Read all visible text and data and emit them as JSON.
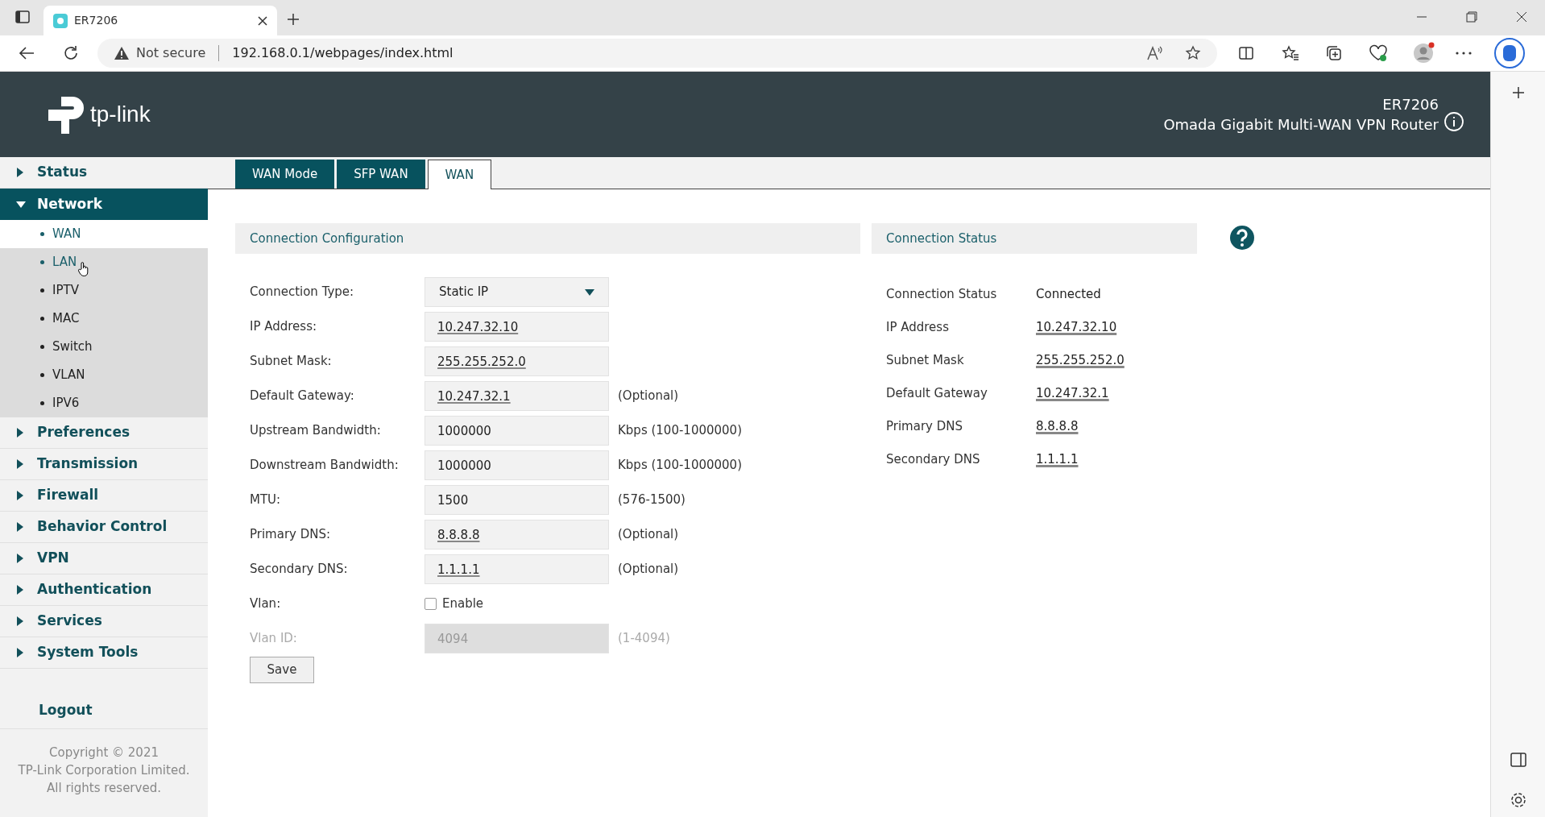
{
  "browser": {
    "tab_title": "ER7206",
    "security": "Not secure",
    "url": "192.168.0.1/webpages/index.html"
  },
  "header": {
    "logo": "tp-link",
    "model": "ER7206",
    "product": "Omada Gigabit Multi-WAN VPN Router"
  },
  "sidebar": {
    "items": [
      {
        "label": "Status",
        "expanded": false
      },
      {
        "label": "Network",
        "expanded": true,
        "children": [
          {
            "label": "WAN",
            "selected": true,
            "hovered": false
          },
          {
            "label": "LAN",
            "selected": false,
            "hovered": true
          },
          {
            "label": "IPTV",
            "selected": false,
            "hovered": false
          },
          {
            "label": "MAC",
            "selected": false,
            "hovered": false
          },
          {
            "label": "Switch",
            "selected": false,
            "hovered": false
          },
          {
            "label": "VLAN",
            "selected": false,
            "hovered": false
          },
          {
            "label": "IPV6",
            "selected": false,
            "hovered": false
          }
        ]
      },
      {
        "label": "Preferences",
        "expanded": false
      },
      {
        "label": "Transmission",
        "expanded": false
      },
      {
        "label": "Firewall",
        "expanded": false
      },
      {
        "label": "Behavior Control",
        "expanded": false
      },
      {
        "label": "VPN",
        "expanded": false
      },
      {
        "label": "Authentication",
        "expanded": false
      },
      {
        "label": "Services",
        "expanded": false
      },
      {
        "label": "System Tools",
        "expanded": false
      }
    ],
    "logout": "Logout",
    "copyright": [
      "Copyright © 2021",
      "TP-Link Corporation Limited.",
      "All rights reserved."
    ]
  },
  "tabs": [
    {
      "label": "WAN Mode",
      "selected": false
    },
    {
      "label": "SFP WAN",
      "selected": false
    },
    {
      "label": "WAN",
      "selected": true
    }
  ],
  "config": {
    "title": "Connection Configuration",
    "fields": [
      {
        "kind": "select",
        "label": "Connection Type:",
        "value": "Static IP",
        "redacted": false,
        "disabled": false
      },
      {
        "kind": "input",
        "label": "IP Address:",
        "value": "10.247.32.10",
        "redacted": true,
        "disabled": false
      },
      {
        "kind": "input",
        "label": "Subnet Mask:",
        "value": "255.255.252.0",
        "redacted": true,
        "disabled": false
      },
      {
        "kind": "input",
        "label": "Default Gateway:",
        "value": "10.247.32.1",
        "hint": "(Optional)",
        "redacted": true,
        "disabled": false
      },
      {
        "kind": "input",
        "label": "Upstream Bandwidth:",
        "value": "1000000",
        "hint": "Kbps (100-1000000)",
        "redacted": false,
        "disabled": false
      },
      {
        "kind": "input",
        "label": "Downstream Bandwidth:",
        "value": "1000000",
        "hint": "Kbps (100-1000000)",
        "redacted": false,
        "disabled": false
      },
      {
        "kind": "input",
        "label": "MTU:",
        "value": "1500",
        "hint": "(576-1500)",
        "redacted": false,
        "disabled": false
      },
      {
        "kind": "input",
        "label": "Primary DNS:",
        "value": "8.8.8.8",
        "hint": "(Optional)",
        "redacted": true,
        "disabled": false
      },
      {
        "kind": "input",
        "label": "Secondary DNS:",
        "value": "1.1.1.1",
        "hint": "(Optional)",
        "redacted": true,
        "disabled": false
      },
      {
        "kind": "checkbox",
        "label": "Vlan:",
        "value": "Enable",
        "checked": false,
        "redacted": false,
        "disabled": false
      },
      {
        "kind": "input",
        "label": "Vlan ID:",
        "value": "4094",
        "hint": "(1-4094)",
        "redacted": false,
        "disabled": true
      }
    ],
    "save": "Save"
  },
  "status": {
    "title": "Connection Status",
    "rows": [
      {
        "label": "Connection Status",
        "value": "Connected",
        "redacted": false
      },
      {
        "label": "IP Address",
        "value": "10.247.32.10",
        "redacted": true
      },
      {
        "label": "Subnet Mask",
        "value": "255.255.252.0",
        "redacted": true
      },
      {
        "label": "Default Gateway",
        "value": "10.247.32.1",
        "redacted": true
      },
      {
        "label": "Primary DNS",
        "value": "8.8.8.8",
        "redacted": true
      },
      {
        "label": "Secondary DNS",
        "value": "1.1.1.1",
        "redacted": true
      }
    ]
  }
}
